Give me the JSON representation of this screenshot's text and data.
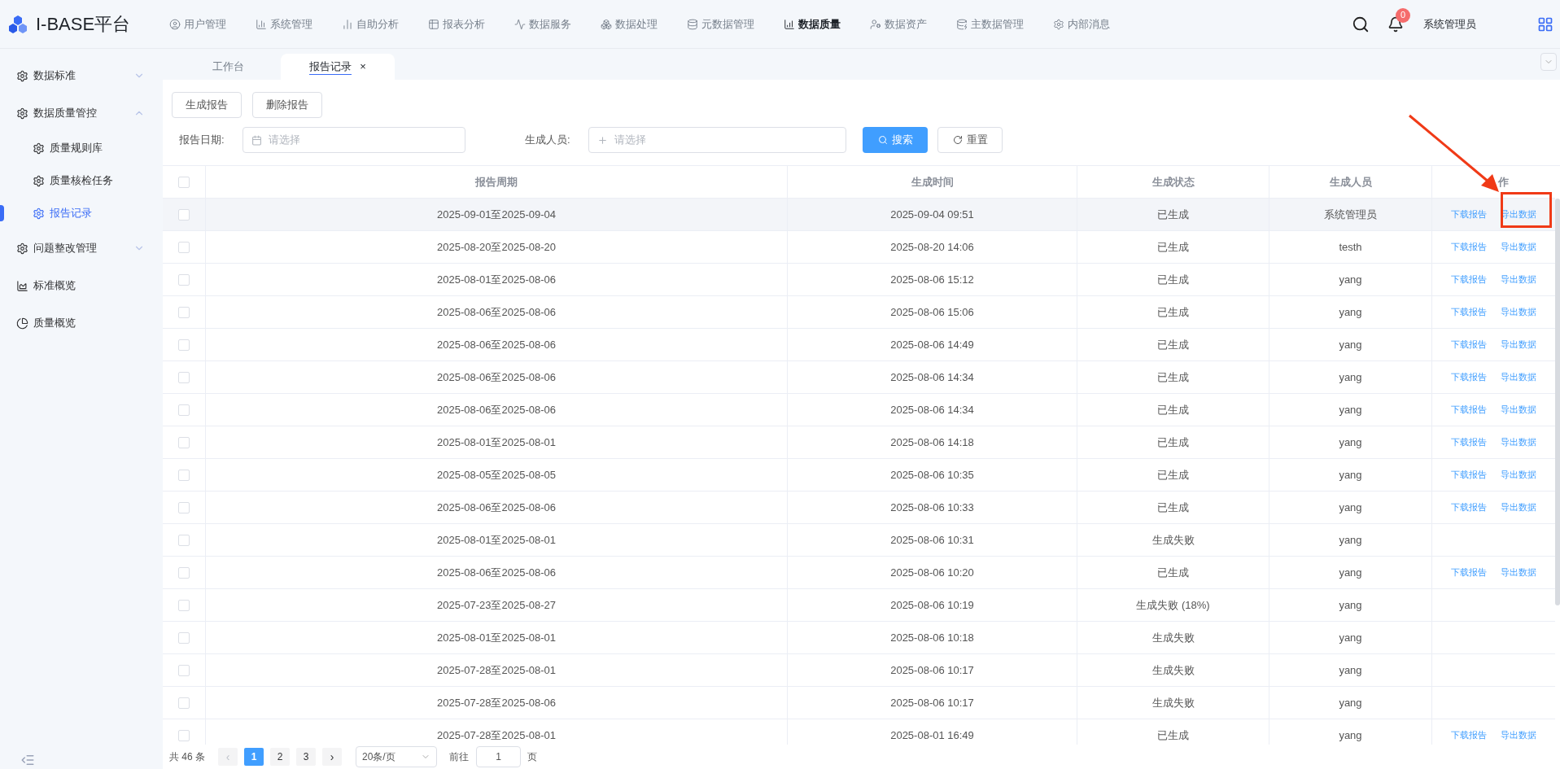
{
  "header": {
    "logo": "I-BASE平台",
    "nav": [
      {
        "label": "用户管理",
        "selected": false
      },
      {
        "label": "系统管理",
        "selected": false
      },
      {
        "label": "自助分析",
        "selected": false
      },
      {
        "label": "报表分析",
        "selected": false
      },
      {
        "label": "数据服务",
        "selected": false
      },
      {
        "label": "数据处理",
        "selected": false
      },
      {
        "label": "元数据管理",
        "selected": false
      },
      {
        "label": "数据质量",
        "selected": true
      },
      {
        "label": "数据资产",
        "selected": false
      },
      {
        "label": "主数据管理",
        "selected": false
      },
      {
        "label": "内部消息",
        "selected": false
      }
    ],
    "notification_count": "0",
    "user": "系统管理员"
  },
  "tabs": [
    {
      "label": "工作台",
      "selected": false,
      "closable": false
    },
    {
      "label": "报告记录",
      "selected": true,
      "closable": true,
      "close": "×"
    }
  ],
  "sidebar": {
    "items": [
      {
        "label": "数据标准",
        "kind": "group",
        "expanded": false,
        "selected": false
      },
      {
        "label": "数据质量管控",
        "kind": "group",
        "expanded": true,
        "selected": false,
        "children": [
          {
            "label": "质量规则库",
            "selected": false
          },
          {
            "label": "质量核检任务",
            "selected": false
          },
          {
            "label": "报告记录",
            "selected": true
          }
        ]
      },
      {
        "label": "问题整改管理",
        "kind": "group",
        "expanded": false,
        "selected": false
      },
      {
        "label": "标准概览",
        "kind": "area",
        "selected": false
      },
      {
        "label": "质量概览",
        "kind": "pie",
        "selected": false
      }
    ]
  },
  "toolbar": {
    "buttons": [
      "生成报告",
      "删除报告"
    ]
  },
  "filters": {
    "fields": [
      {
        "label": "报告日期:",
        "placeholder": "请选择",
        "kind": "date"
      },
      {
        "label": "生成人员:",
        "placeholder": "请选择",
        "kind": "add"
      }
    ],
    "search": "搜索",
    "reset": "重置"
  },
  "table": {
    "columns": [
      "报告周期",
      "生成时间",
      "生成状态",
      "生成人员",
      "作"
    ],
    "header_checked": false,
    "rows": [
      {
        "period": "2025-09-01至2025-09-04",
        "time": "2025-09-04 09:51",
        "status": "已生成",
        "person": "系统管理员",
        "actions": [
          "下载报告",
          "导出数据"
        ],
        "checked": false,
        "highlighted": true
      },
      {
        "period": "2025-08-20至2025-08-20",
        "time": "2025-08-20 14:06",
        "status": "已生成",
        "person": "testh",
        "actions": [
          "下载报告",
          "导出数据"
        ],
        "checked": false,
        "highlighted": false
      },
      {
        "period": "2025-08-01至2025-08-06",
        "time": "2025-08-06 15:12",
        "status": "已生成",
        "person": "yang",
        "actions": [
          "下载报告",
          "导出数据"
        ],
        "checked": false,
        "highlighted": false
      },
      {
        "period": "2025-08-06至2025-08-06",
        "time": "2025-08-06 15:06",
        "status": "已生成",
        "person": "yang",
        "actions": [
          "下载报告",
          "导出数据"
        ],
        "checked": false,
        "highlighted": false
      },
      {
        "period": "2025-08-06至2025-08-06",
        "time": "2025-08-06 14:49",
        "status": "已生成",
        "person": "yang",
        "actions": [
          "下载报告",
          "导出数据"
        ],
        "checked": false,
        "highlighted": false
      },
      {
        "period": "2025-08-06至2025-08-06",
        "time": "2025-08-06 14:34",
        "status": "已生成",
        "person": "yang",
        "actions": [
          "下载报告",
          "导出数据"
        ],
        "checked": false,
        "highlighted": false
      },
      {
        "period": "2025-08-06至2025-08-06",
        "time": "2025-08-06 14:34",
        "status": "已生成",
        "person": "yang",
        "actions": [
          "下载报告",
          "导出数据"
        ],
        "checked": false,
        "highlighted": false
      },
      {
        "period": "2025-08-01至2025-08-01",
        "time": "2025-08-06 14:18",
        "status": "已生成",
        "person": "yang",
        "actions": [
          "下载报告",
          "导出数据"
        ],
        "checked": false,
        "highlighted": false
      },
      {
        "period": "2025-08-05至2025-08-05",
        "time": "2025-08-06 10:35",
        "status": "已生成",
        "person": "yang",
        "actions": [
          "下载报告",
          "导出数据"
        ],
        "checked": false,
        "highlighted": false
      },
      {
        "period": "2025-08-06至2025-08-06",
        "time": "2025-08-06 10:33",
        "status": "已生成",
        "person": "yang",
        "actions": [
          "下载报告",
          "导出数据"
        ],
        "checked": false,
        "highlighted": false
      },
      {
        "period": "2025-08-01至2025-08-01",
        "time": "2025-08-06 10:31",
        "status": "生成失败",
        "person": "yang",
        "checked": false,
        "highlighted": false
      },
      {
        "period": "2025-08-06至2025-08-06",
        "time": "2025-08-06 10:20",
        "status": "已生成",
        "person": "yang",
        "actions": [
          "下载报告",
          "导出数据"
        ],
        "checked": false,
        "highlighted": false
      },
      {
        "period": "2025-07-23至2025-08-27",
        "time": "2025-08-06 10:19",
        "status": "生成失败 (18%)",
        "person": "yang",
        "checked": false,
        "highlighted": false
      },
      {
        "period": "2025-08-01至2025-08-01",
        "time": "2025-08-06 10:18",
        "status": "生成失败",
        "person": "yang",
        "checked": false,
        "highlighted": false
      },
      {
        "period": "2025-07-28至2025-08-01",
        "time": "2025-08-06 10:17",
        "status": "生成失败",
        "person": "yang",
        "checked": false,
        "highlighted": false
      },
      {
        "period": "2025-07-28至2025-08-06",
        "time": "2025-08-06 10:17",
        "status": "生成失败",
        "person": "yang",
        "checked": false,
        "highlighted": false
      },
      {
        "period": "2025-07-28至2025-08-01",
        "time": "2025-08-01 16:49",
        "status": "已生成",
        "person": "yang",
        "actions": [
          "下载报告",
          "导出数据"
        ],
        "checked": false,
        "highlighted": false
      }
    ]
  },
  "pagination": {
    "total": "共 46 条",
    "prev": "‹",
    "pages": [
      {
        "label": "1",
        "selected": true
      },
      {
        "label": "2",
        "selected": false
      },
      {
        "label": "3",
        "selected": false
      }
    ],
    "next": "›",
    "page_size": "20条/页",
    "goto_label": "前往",
    "goto_value": "1",
    "goto_unit": "页"
  }
}
